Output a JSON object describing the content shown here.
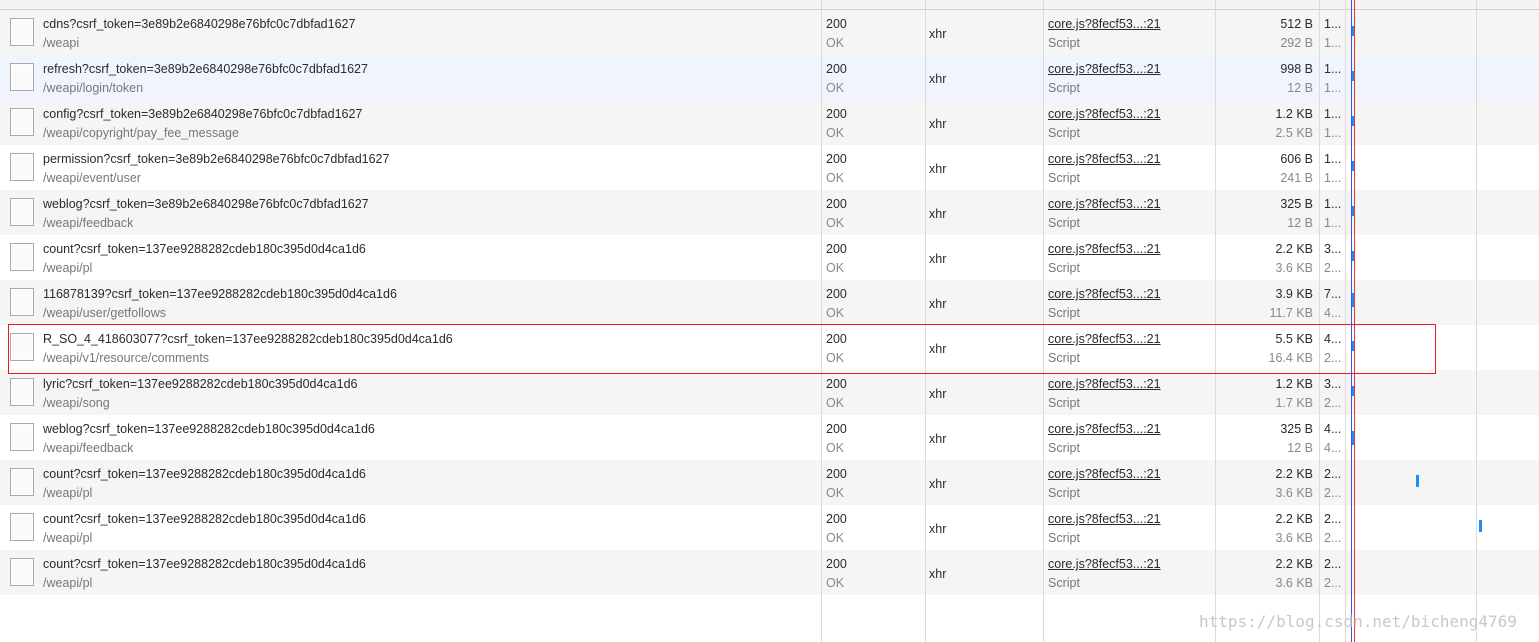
{
  "colors": {
    "waterfall_bar": "#1b8ff2",
    "dom_content_loaded_line": "#3f51f5",
    "load_line": "#e53935",
    "highlight_border": "#e02020"
  },
  "requests": [
    {
      "name": "cdns?csrf_token=3e89b2e6840298e76bfc0c7dbfad1627",
      "path": "/weapi",
      "status": "200",
      "status_text": "OK",
      "type": "xhr",
      "initiator": "core.js?8fecf53...:21",
      "initiator_type": "Script",
      "size": "512 B",
      "content": "292 B",
      "time": "1...",
      "latency": "1...",
      "waterfall_ms": 1,
      "icon": "document-icon"
    },
    {
      "name": "refresh?csrf_token=3e89b2e6840298e76bfc0c7dbfad1627",
      "path": "/weapi/login/token",
      "status": "200",
      "status_text": "OK",
      "type": "xhr",
      "initiator": "core.js?8fecf53...:21",
      "initiator_type": "Script",
      "size": "998 B",
      "content": "12 B",
      "time": "1...",
      "latency": "1...",
      "waterfall_ms": 1,
      "icon": "document-icon"
    },
    {
      "name": "config?csrf_token=3e89b2e6840298e76bfc0c7dbfad1627",
      "path": "/weapi/copyright/pay_fee_message",
      "status": "200",
      "status_text": "OK",
      "type": "xhr",
      "initiator": "core.js?8fecf53...:21",
      "initiator_type": "Script",
      "size": "1.2 KB",
      "content": "2.5 KB",
      "time": "1...",
      "latency": "1...",
      "waterfall_ms": 1,
      "icon": "document-icon"
    },
    {
      "name": "permission?csrf_token=3e89b2e6840298e76bfc0c7dbfad1627",
      "path": "/weapi/event/user",
      "status": "200",
      "status_text": "OK",
      "type": "xhr",
      "initiator": "core.js?8fecf53...:21",
      "initiator_type": "Script",
      "size": "606 B",
      "content": "241 B",
      "time": "1...",
      "latency": "1...",
      "waterfall_ms": 1,
      "icon": "document-icon"
    },
    {
      "name": "weblog?csrf_token=3e89b2e6840298e76bfc0c7dbfad1627",
      "path": "/weapi/feedback",
      "status": "200",
      "status_text": "OK",
      "type": "xhr",
      "initiator": "core.js?8fecf53...:21",
      "initiator_type": "Script",
      "size": "325 B",
      "content": "12 B",
      "time": "1...",
      "latency": "1...",
      "waterfall_ms": 1,
      "icon": "document-icon"
    },
    {
      "name": "count?csrf_token=137ee9288282cdeb180c395d0d4ca1d6",
      "path": "/weapi/pl",
      "status": "200",
      "status_text": "OK",
      "type": "xhr",
      "initiator": "core.js?8fecf53...:21",
      "initiator_type": "Script",
      "size": "2.2 KB",
      "content": "3.6 KB",
      "time": "3...",
      "latency": "2...",
      "waterfall_ms": 1,
      "icon": "document-icon"
    },
    {
      "name": "116878139?csrf_token=137ee9288282cdeb180c395d0d4ca1d6",
      "path": "/weapi/user/getfollows",
      "status": "200",
      "status_text": "OK",
      "type": "xhr",
      "initiator": "core.js?8fecf53...:21",
      "initiator_type": "Script",
      "size": "3.9 KB",
      "content": "11.7 KB",
      "time": "7...",
      "latency": "4...",
      "waterfall_ms": 1,
      "icon": "document-icon"
    },
    {
      "name": "R_SO_4_418603077?csrf_token=137ee9288282cdeb180c395d0d4ca1d6",
      "path": "/weapi/v1/resource/comments",
      "status": "200",
      "status_text": "OK",
      "type": "xhr",
      "initiator": "core.js?8fecf53...:21",
      "initiator_type": "Script",
      "size": "5.5 KB",
      "content": "16.4 KB",
      "time": "4...",
      "latency": "2...",
      "waterfall_ms": 1,
      "icon": "document-icon"
    },
    {
      "name": "lyric?csrf_token=137ee9288282cdeb180c395d0d4ca1d6",
      "path": "/weapi/song",
      "status": "200",
      "status_text": "OK",
      "type": "xhr",
      "initiator": "core.js?8fecf53...:21",
      "initiator_type": "Script",
      "size": "1.2 KB",
      "content": "1.7 KB",
      "time": "3...",
      "latency": "2...",
      "waterfall_ms": 1,
      "icon": "document-icon"
    },
    {
      "name": "weblog?csrf_token=137ee9288282cdeb180c395d0d4ca1d6",
      "path": "/weapi/feedback",
      "status": "200",
      "status_text": "OK",
      "type": "xhr",
      "initiator": "core.js?8fecf53...:21",
      "initiator_type": "Script",
      "size": "325 B",
      "content": "12 B",
      "time": "4...",
      "latency": "4...",
      "waterfall_ms": 1,
      "icon": "document-icon"
    },
    {
      "name": "count?csrf_token=137ee9288282cdeb180c395d0d4ca1d6",
      "path": "/weapi/pl",
      "status": "200",
      "status_text": "OK",
      "type": "xhr",
      "initiator": "core.js?8fecf53...:21",
      "initiator_type": "Script",
      "size": "2.2 KB",
      "content": "3.6 KB",
      "time": "2...",
      "latency": "2...",
      "waterfall_ms": 1,
      "icon": "document-icon"
    },
    {
      "name": "count?csrf_token=137ee9288282cdeb180c395d0d4ca1d6",
      "path": "/weapi/pl",
      "status": "200",
      "status_text": "OK",
      "type": "xhr",
      "initiator": "core.js?8fecf53...:21",
      "initiator_type": "Script",
      "size": "2.2 KB",
      "content": "3.6 KB",
      "time": "2...",
      "latency": "2...",
      "waterfall_ms": 1,
      "icon": "document-icon"
    },
    {
      "name": "count?csrf_token=137ee9288282cdeb180c395d0d4ca1d6",
      "path": "/weapi/pl",
      "status": "200",
      "status_text": "OK",
      "type": "xhr",
      "initiator": "core.js?8fecf53...:21",
      "initiator_type": "Script",
      "size": "2.2 KB",
      "content": "3.6 KB",
      "time": "2...",
      "latency": "2...",
      "waterfall_ms": 1,
      "icon": "document-icon"
    }
  ],
  "watermark": "https://blog.csdn.net/bicheng4769"
}
